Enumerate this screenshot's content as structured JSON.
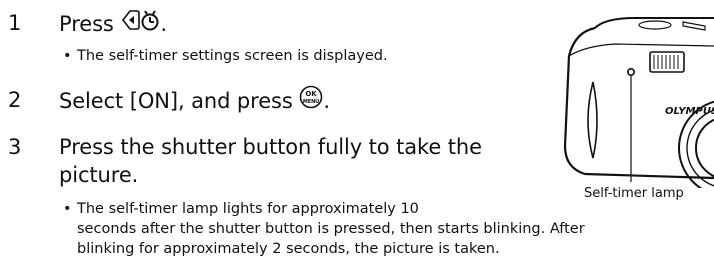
{
  "steps": [
    {
      "number": "1",
      "text": "Press",
      "suffix": ".",
      "icon": "self-timer-button-icon",
      "bullets": [
        "The self-timer settings screen is displayed."
      ]
    },
    {
      "number": "2",
      "text": "Select [ON], and press",
      "suffix": ".",
      "icon": "ok-menu-button-icon"
    },
    {
      "number": "3",
      "text_line1": "Press the shutter button fully to take the",
      "text_line2": "picture.",
      "bullet_lines": [
        "The self-timer lamp lights for approximately 10",
        "seconds after the shutter button is pressed, then starts blinking. After",
        "blinking for approximately 2 seconds, the picture is taken."
      ]
    }
  ],
  "figure": {
    "caption": "Self-timer lamp",
    "brand": "OLYMPUS",
    "icon": "camera-illustration"
  },
  "icons": {
    "ok_top": "OK",
    "ok_bottom": "MENU"
  }
}
